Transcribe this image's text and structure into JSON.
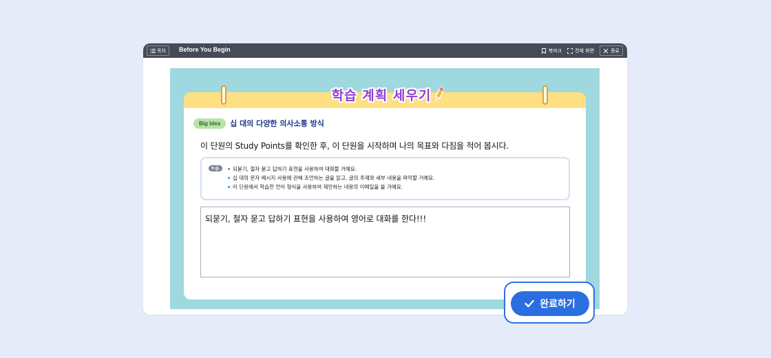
{
  "titlebar": {
    "toc_label": "목차",
    "title": "Before You Begin",
    "bookmark_label": "북마크",
    "fullscreen_label": "전체 화면",
    "close_label": "종료"
  },
  "plan": {
    "title": "학습 계획 세우기"
  },
  "big_idea": {
    "badge": "Big Idea",
    "text": "십 대의 다양한 의사소통 방식"
  },
  "instruction": "이 단원의 Study Points를 확인한 후, 이 단원을 시작하며 나의 목표와 다짐을 적어 봅시다.",
  "example": {
    "badge": "e.g.",
    "items": [
      "되묻기, 철자 묻고 답하기 표현을 사용하여 대화할 거예요.",
      "십 대의 문자 메시지 사용에 관해 조언하는 글을 읽고, 글의 주제와 세부 내용을 파악할 거예요.",
      "이 단원에서 학습한 언어 형식을 사용하여 제안하는 내용의 이메일을 쓸 거예요."
    ]
  },
  "answer": {
    "value": "되묻기, 철자 묻고 답하기 표현을 사용하여 영어로 대화를 한다!!!"
  },
  "done_button": {
    "label": "완료하기"
  },
  "colors": {
    "titlebar": "#454b57",
    "teal": "#9fd8df",
    "yellow": "#fedf84",
    "accent_blue": "#2a6fe0",
    "title_purple": "#8f3fd0"
  }
}
